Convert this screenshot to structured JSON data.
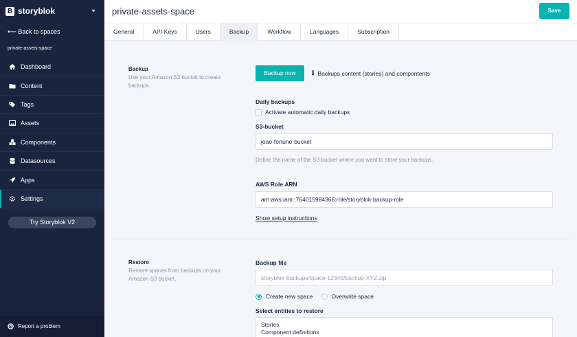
{
  "sidebar": {
    "brand": "storyblok",
    "back_link": "Back to spaces",
    "space_name": "private-assets-space",
    "nav": [
      {
        "label": "Dashboard",
        "icon": "home-icon"
      },
      {
        "label": "Content",
        "icon": "folder-icon"
      },
      {
        "label": "Tags",
        "icon": "tags-icon"
      },
      {
        "label": "Assets",
        "icon": "image-icon"
      },
      {
        "label": "Components",
        "icon": "cubes-icon"
      },
      {
        "label": "Datasources",
        "icon": "database-icon"
      },
      {
        "label": "Apps",
        "icon": "rocket-icon"
      },
      {
        "label": "Settings",
        "icon": "gear-icon",
        "active": true
      }
    ],
    "try_button": "Try Storyblok V2",
    "report": "Report a problem"
  },
  "header": {
    "title": "private-assets-space",
    "save_label": "Save"
  },
  "tabs": [
    "General",
    "API-Keys",
    "Users",
    "Backup",
    "Workflow",
    "Languages",
    "Subscription"
  ],
  "active_tab": "Backup",
  "backup": {
    "title": "Backup",
    "description": "Use your Amazon S3 bucket to create backups.",
    "button": "Backup now",
    "info": "Backups content (stories) and compontents",
    "daily_label": "Daily backups",
    "daily_checkbox": "Activate automatic daily backups",
    "daily_checked": false,
    "s3_label": "S3-bucket",
    "s3_value": "joao-fortune-bucket",
    "s3_help": "Define the name of the S3-bucket where you want to store your backups.",
    "arn_label": "AWS Role ARN",
    "arn_value": "arn:aws:iam::764015984366:role/storyblok-backup-role",
    "setup_link": "Show setup instructions"
  },
  "restore": {
    "title": "Restore",
    "description": "Restore spaces from backups on your Amazon S3 bucket.",
    "file_label": "Backup file",
    "file_placeholder": "storyblok-backups/space-12345/backup-XYZ.zip",
    "option_new": "Create new space",
    "option_overwrite": "Overwrite space",
    "selected_option": "Create new space",
    "entities_label": "Select entities to restore",
    "entities": [
      "Stories",
      "Component definitions"
    ]
  },
  "colors": {
    "sidebar_bg": "#1b243f",
    "accent": "#09b3af",
    "page_bg": "#f5f6f9"
  }
}
